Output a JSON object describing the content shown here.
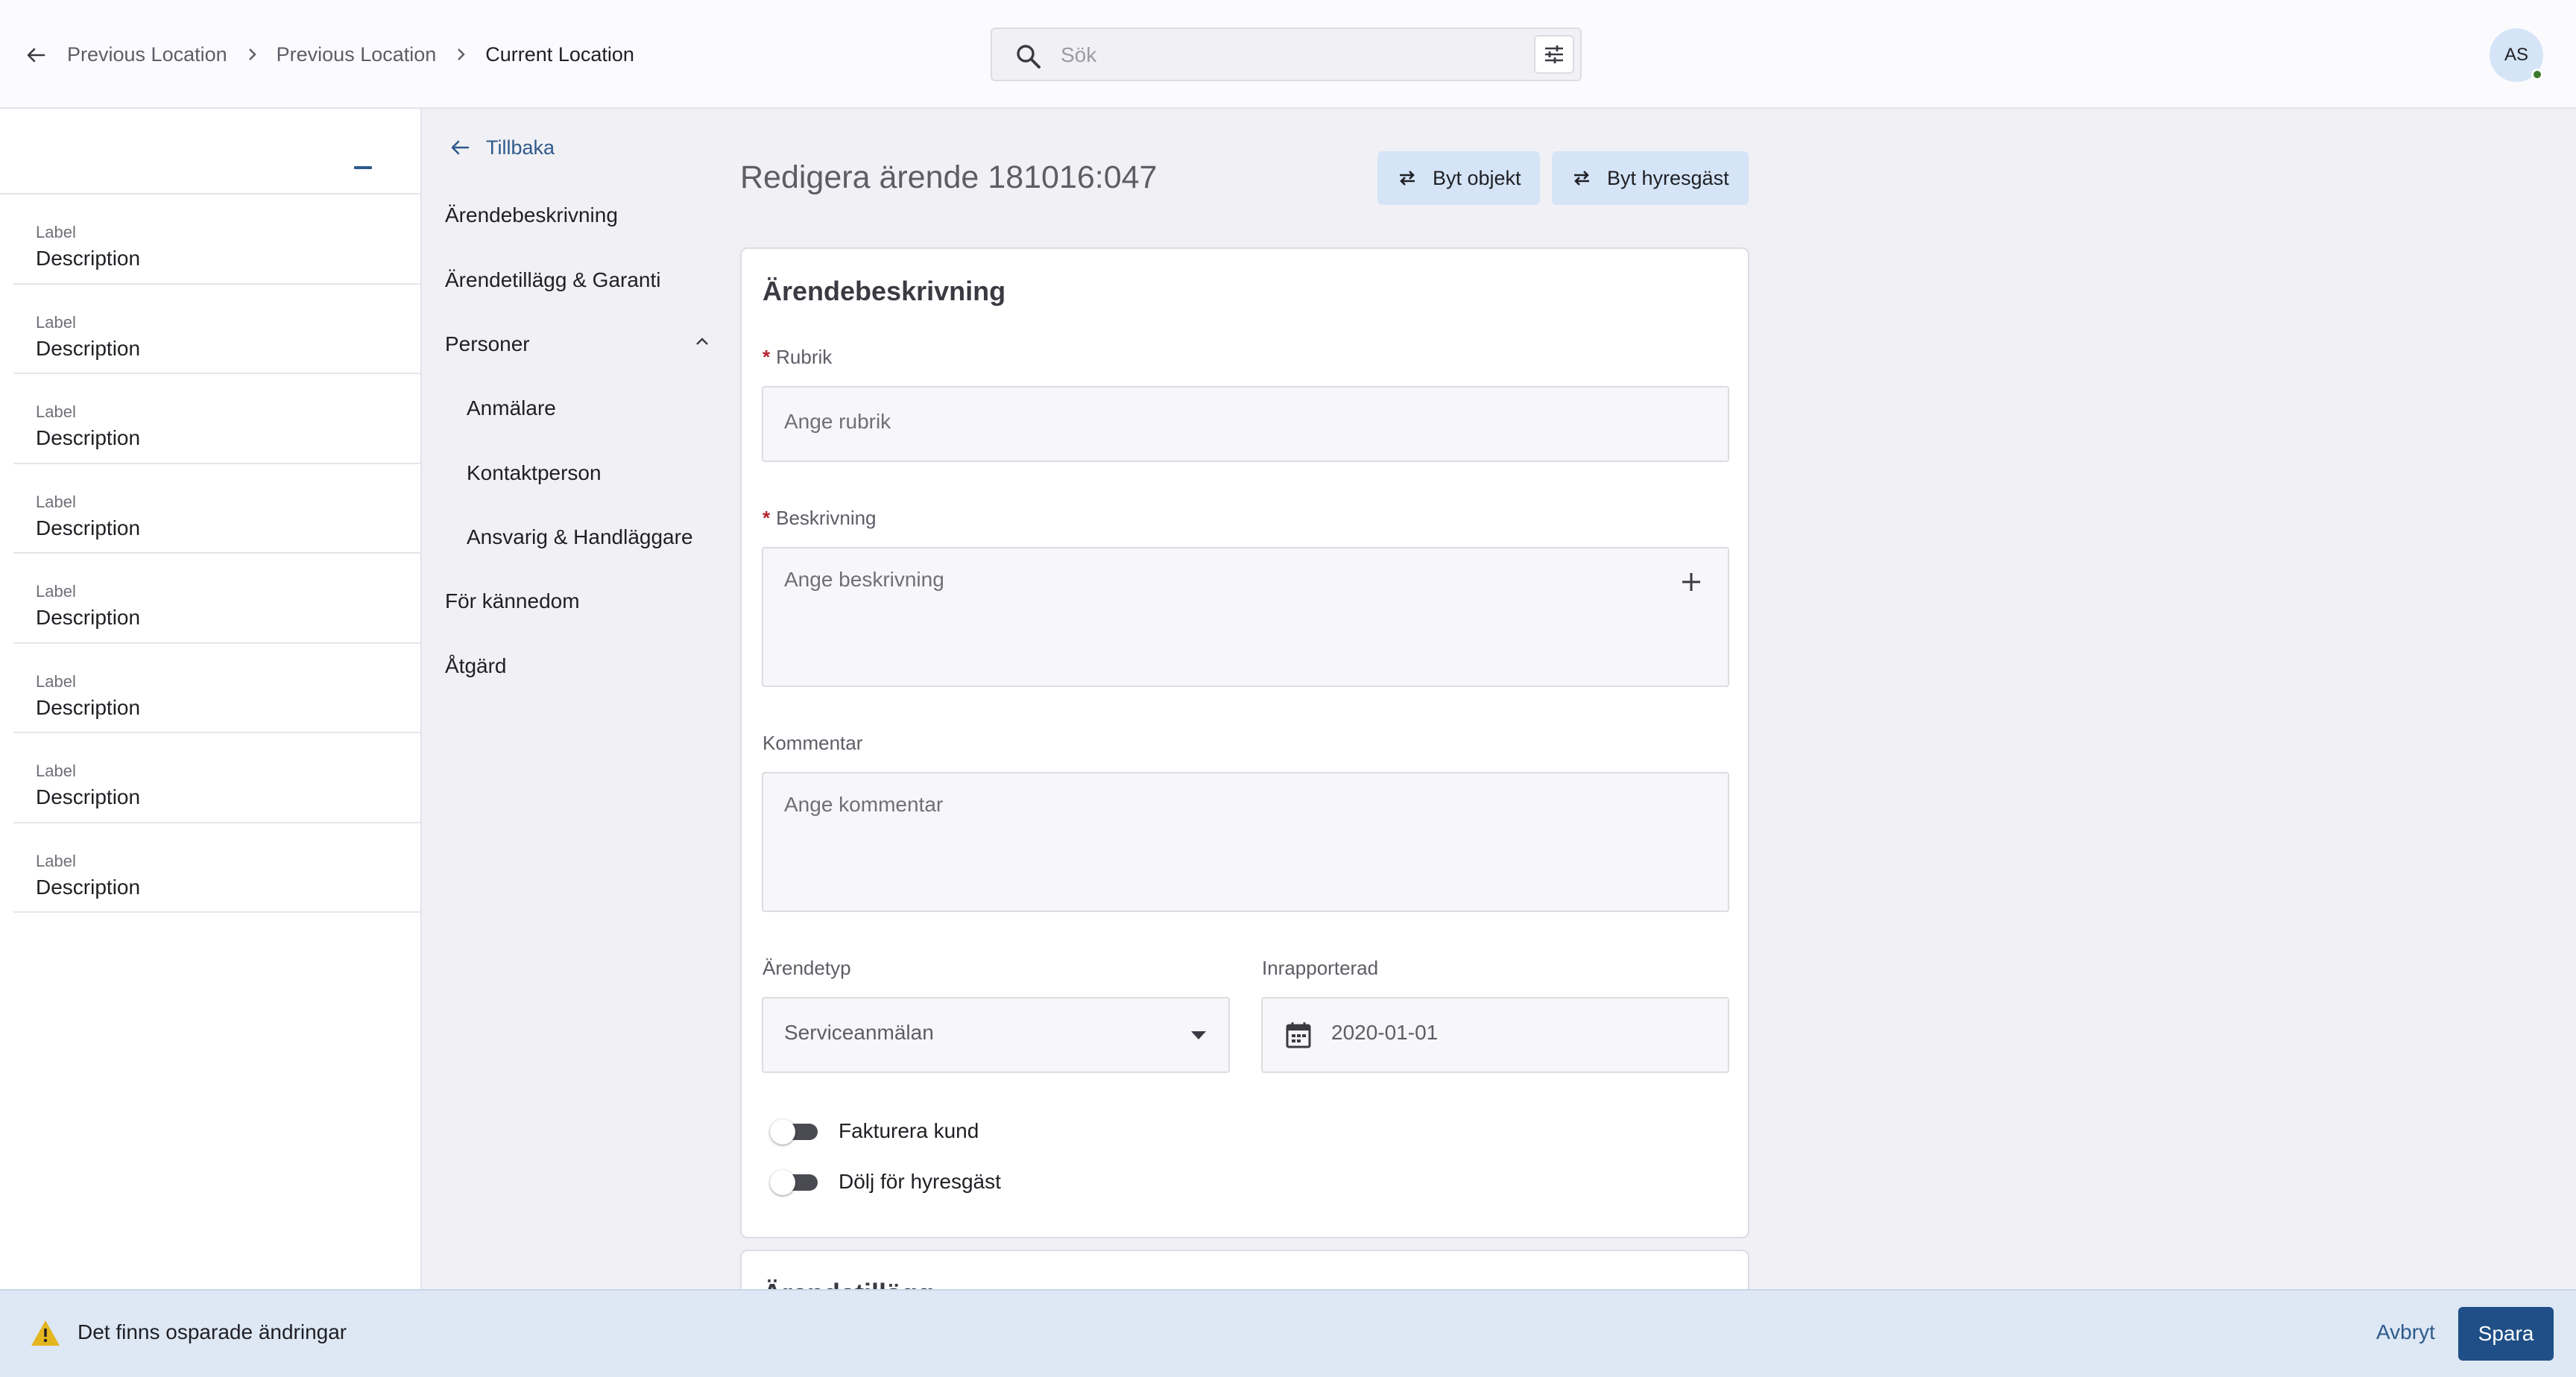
{
  "breadcrumb": {
    "items": [
      "Previous Location",
      "Previous Location"
    ],
    "current": "Current Location"
  },
  "search": {
    "placeholder": "Sök"
  },
  "user": {
    "initials": "AS",
    "status_color": "#3d7a2c"
  },
  "left_panel": {
    "items": [
      {
        "label": "Label",
        "description": "Description"
      },
      {
        "label": "Label",
        "description": "Description"
      },
      {
        "label": "Label",
        "description": "Description"
      },
      {
        "label": "Label",
        "description": "Description"
      },
      {
        "label": "Label",
        "description": "Description"
      },
      {
        "label": "Label",
        "description": "Description"
      },
      {
        "label": "Label",
        "description": "Description"
      },
      {
        "label": "Label",
        "description": "Description"
      }
    ]
  },
  "nav": {
    "back": "Tillbaka",
    "items": [
      "Ärendebeskrivning",
      "Ärendetillägg & Garanti",
      "Personer",
      "Anmälare",
      "Kontaktperson",
      "Ansvarig & Handläggare",
      "För kännedom",
      "Åtgärd"
    ]
  },
  "page": {
    "title": "Redigera ärende 181016:047",
    "actions": {
      "swap_object": "Byt objekt",
      "swap_tenant": "Byt hyresgäst"
    }
  },
  "form": {
    "section_title": "Ärendebeskrivning",
    "required_mark": "*",
    "rubrik": {
      "label": "Rubrik",
      "placeholder": "Ange rubrik"
    },
    "beskrivning": {
      "label": "Beskrivning",
      "placeholder": "Ange beskrivning"
    },
    "kommentar": {
      "label": "Kommentar",
      "placeholder": "Ange kommentar"
    },
    "arendetyp": {
      "label": "Ärendetyp",
      "value": "Serviceanmälan"
    },
    "inrapporterad": {
      "label": "Inrapporterad",
      "value": "2020-01-01"
    },
    "toggles": [
      "Fakturera kund",
      "Dölj för hyresgäst"
    ]
  },
  "next_section": {
    "title": "Ärendetillägg"
  },
  "footer": {
    "message": "Det finns osparade ändringar",
    "cancel": "Avbryt",
    "save": "Spara"
  },
  "colors": {
    "accent": "#1f4f86",
    "link": "#2e5a8c",
    "action_bg": "#d5e5f7",
    "footer_bg": "#dde8f4",
    "warning": "#e3b51e",
    "required": "#b4232d"
  }
}
